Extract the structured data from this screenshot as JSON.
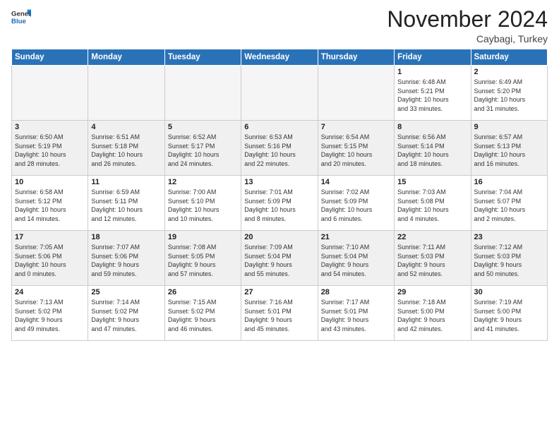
{
  "header": {
    "logo_general": "General",
    "logo_blue": "Blue",
    "month": "November 2024",
    "location": "Caybagi, Turkey"
  },
  "weekdays": [
    "Sunday",
    "Monday",
    "Tuesday",
    "Wednesday",
    "Thursday",
    "Friday",
    "Saturday"
  ],
  "weeks": [
    [
      {
        "day": "",
        "info": "",
        "empty": true
      },
      {
        "day": "",
        "info": "",
        "empty": true
      },
      {
        "day": "",
        "info": "",
        "empty": true
      },
      {
        "day": "",
        "info": "",
        "empty": true
      },
      {
        "day": "",
        "info": "",
        "empty": true
      },
      {
        "day": "1",
        "info": "Sunrise: 6:48 AM\nSunset: 5:21 PM\nDaylight: 10 hours\nand 33 minutes."
      },
      {
        "day": "2",
        "info": "Sunrise: 6:49 AM\nSunset: 5:20 PM\nDaylight: 10 hours\nand 31 minutes."
      }
    ],
    [
      {
        "day": "3",
        "info": "Sunrise: 6:50 AM\nSunset: 5:19 PM\nDaylight: 10 hours\nand 28 minutes."
      },
      {
        "day": "4",
        "info": "Sunrise: 6:51 AM\nSunset: 5:18 PM\nDaylight: 10 hours\nand 26 minutes."
      },
      {
        "day": "5",
        "info": "Sunrise: 6:52 AM\nSunset: 5:17 PM\nDaylight: 10 hours\nand 24 minutes."
      },
      {
        "day": "6",
        "info": "Sunrise: 6:53 AM\nSunset: 5:16 PM\nDaylight: 10 hours\nand 22 minutes."
      },
      {
        "day": "7",
        "info": "Sunrise: 6:54 AM\nSunset: 5:15 PM\nDaylight: 10 hours\nand 20 minutes."
      },
      {
        "day": "8",
        "info": "Sunrise: 6:56 AM\nSunset: 5:14 PM\nDaylight: 10 hours\nand 18 minutes."
      },
      {
        "day": "9",
        "info": "Sunrise: 6:57 AM\nSunset: 5:13 PM\nDaylight: 10 hours\nand 16 minutes."
      }
    ],
    [
      {
        "day": "10",
        "info": "Sunrise: 6:58 AM\nSunset: 5:12 PM\nDaylight: 10 hours\nand 14 minutes."
      },
      {
        "day": "11",
        "info": "Sunrise: 6:59 AM\nSunset: 5:11 PM\nDaylight: 10 hours\nand 12 minutes."
      },
      {
        "day": "12",
        "info": "Sunrise: 7:00 AM\nSunset: 5:10 PM\nDaylight: 10 hours\nand 10 minutes."
      },
      {
        "day": "13",
        "info": "Sunrise: 7:01 AM\nSunset: 5:09 PM\nDaylight: 10 hours\nand 8 minutes."
      },
      {
        "day": "14",
        "info": "Sunrise: 7:02 AM\nSunset: 5:09 PM\nDaylight: 10 hours\nand 6 minutes."
      },
      {
        "day": "15",
        "info": "Sunrise: 7:03 AM\nSunset: 5:08 PM\nDaylight: 10 hours\nand 4 minutes."
      },
      {
        "day": "16",
        "info": "Sunrise: 7:04 AM\nSunset: 5:07 PM\nDaylight: 10 hours\nand 2 minutes."
      }
    ],
    [
      {
        "day": "17",
        "info": "Sunrise: 7:05 AM\nSunset: 5:06 PM\nDaylight: 10 hours\nand 0 minutes."
      },
      {
        "day": "18",
        "info": "Sunrise: 7:07 AM\nSunset: 5:06 PM\nDaylight: 9 hours\nand 59 minutes."
      },
      {
        "day": "19",
        "info": "Sunrise: 7:08 AM\nSunset: 5:05 PM\nDaylight: 9 hours\nand 57 minutes."
      },
      {
        "day": "20",
        "info": "Sunrise: 7:09 AM\nSunset: 5:04 PM\nDaylight: 9 hours\nand 55 minutes."
      },
      {
        "day": "21",
        "info": "Sunrise: 7:10 AM\nSunset: 5:04 PM\nDaylight: 9 hours\nand 54 minutes."
      },
      {
        "day": "22",
        "info": "Sunrise: 7:11 AM\nSunset: 5:03 PM\nDaylight: 9 hours\nand 52 minutes."
      },
      {
        "day": "23",
        "info": "Sunrise: 7:12 AM\nSunset: 5:03 PM\nDaylight: 9 hours\nand 50 minutes."
      }
    ],
    [
      {
        "day": "24",
        "info": "Sunrise: 7:13 AM\nSunset: 5:02 PM\nDaylight: 9 hours\nand 49 minutes."
      },
      {
        "day": "25",
        "info": "Sunrise: 7:14 AM\nSunset: 5:02 PM\nDaylight: 9 hours\nand 47 minutes."
      },
      {
        "day": "26",
        "info": "Sunrise: 7:15 AM\nSunset: 5:02 PM\nDaylight: 9 hours\nand 46 minutes."
      },
      {
        "day": "27",
        "info": "Sunrise: 7:16 AM\nSunset: 5:01 PM\nDaylight: 9 hours\nand 45 minutes."
      },
      {
        "day": "28",
        "info": "Sunrise: 7:17 AM\nSunset: 5:01 PM\nDaylight: 9 hours\nand 43 minutes."
      },
      {
        "day": "29",
        "info": "Sunrise: 7:18 AM\nSunset: 5:00 PM\nDaylight: 9 hours\nand 42 minutes."
      },
      {
        "day": "30",
        "info": "Sunrise: 7:19 AM\nSunset: 5:00 PM\nDaylight: 9 hours\nand 41 minutes."
      }
    ]
  ]
}
